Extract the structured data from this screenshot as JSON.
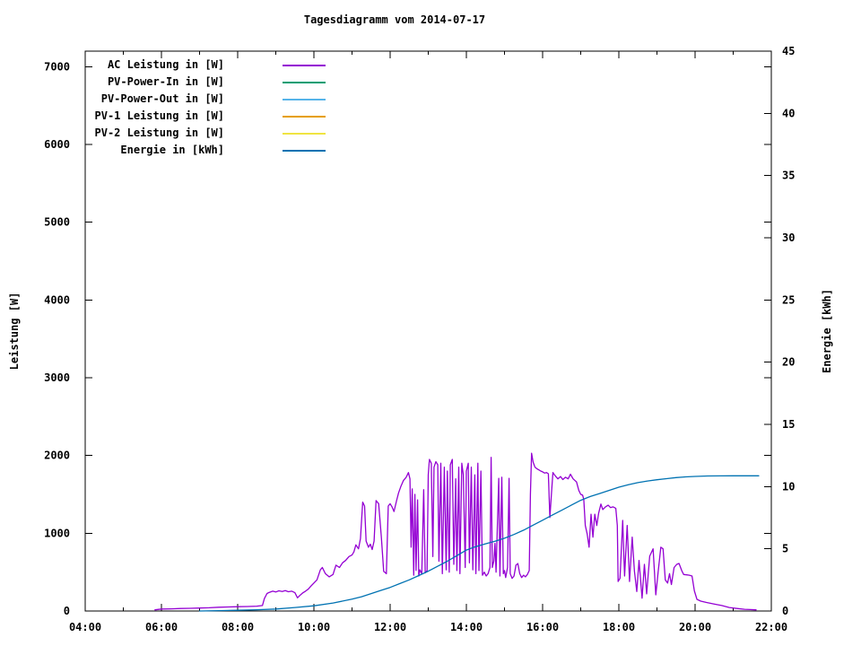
{
  "chart_data": {
    "type": "line",
    "title": "Tagesdiagramm vom 2014-07-17",
    "xlabel": "",
    "ylabel": "Leistung [W]",
    "y2label": "Energie [kWh]",
    "xlim": [
      4,
      22
    ],
    "ylim": [
      0,
      7200
    ],
    "y2lim": [
      0,
      45
    ],
    "x_major_ticks": [
      4,
      6,
      8,
      10,
      12,
      14,
      16,
      18,
      20,
      22
    ],
    "x_major_labels": [
      "04:00",
      "06:00",
      "08:00",
      "10:00",
      "12:00",
      "14:00",
      "16:00",
      "18:00",
      "20:00",
      "22:00"
    ],
    "x_minor_ticks": [
      5,
      7,
      9,
      11,
      13,
      15,
      17,
      19,
      21
    ],
    "y_ticks": [
      0,
      1000,
      2000,
      3000,
      4000,
      5000,
      6000,
      7000
    ],
    "y2_ticks": [
      0,
      5,
      10,
      15,
      20,
      25,
      30,
      35,
      40,
      45
    ],
    "grid": false,
    "legend_position": "top-left-inside",
    "series": [
      {
        "name": "AC Leistung in [W]",
        "color": "#9400d3",
        "axis": "y1",
        "points": [
          [
            5.83,
            15
          ],
          [
            6.0,
            25
          ],
          [
            6.25,
            28
          ],
          [
            6.5,
            32
          ],
          [
            6.75,
            35
          ],
          [
            7.0,
            38
          ],
          [
            7.25,
            42
          ],
          [
            7.5,
            48
          ],
          [
            7.75,
            52
          ],
          [
            8.0,
            55
          ],
          [
            8.25,
            58
          ],
          [
            8.5,
            62
          ],
          [
            8.65,
            70
          ],
          [
            8.7,
            160
          ],
          [
            8.77,
            225
          ],
          [
            8.83,
            240
          ],
          [
            8.92,
            255
          ],
          [
            9.0,
            245
          ],
          [
            9.08,
            260
          ],
          [
            9.17,
            250
          ],
          [
            9.25,
            262
          ],
          [
            9.33,
            248
          ],
          [
            9.42,
            255
          ],
          [
            9.5,
            235
          ],
          [
            9.57,
            170
          ],
          [
            9.63,
            200
          ],
          [
            9.7,
            230
          ],
          [
            9.78,
            255
          ],
          [
            9.85,
            280
          ],
          [
            9.92,
            320
          ],
          [
            10.0,
            360
          ],
          [
            10.08,
            400
          ],
          [
            10.17,
            530
          ],
          [
            10.22,
            560
          ],
          [
            10.3,
            480
          ],
          [
            10.4,
            440
          ],
          [
            10.5,
            470
          ],
          [
            10.58,
            590
          ],
          [
            10.67,
            560
          ],
          [
            10.75,
            620
          ],
          [
            10.83,
            650
          ],
          [
            10.92,
            700
          ],
          [
            11.0,
            720
          ],
          [
            11.05,
            760
          ],
          [
            11.1,
            850
          ],
          [
            11.17,
            800
          ],
          [
            11.22,
            930
          ],
          [
            11.28,
            1400
          ],
          [
            11.33,
            1350
          ],
          [
            11.37,
            900
          ],
          [
            11.43,
            820
          ],
          [
            11.48,
            860
          ],
          [
            11.53,
            790
          ],
          [
            11.58,
            900
          ],
          [
            11.63,
            1420
          ],
          [
            11.7,
            1380
          ],
          [
            11.77,
            950
          ],
          [
            11.83,
            510
          ],
          [
            11.9,
            480
          ],
          [
            11.95,
            1350
          ],
          [
            12.0,
            1380
          ],
          [
            12.05,
            1340
          ],
          [
            12.1,
            1280
          ],
          [
            12.17,
            1420
          ],
          [
            12.22,
            1520
          ],
          [
            12.28,
            1600
          ],
          [
            12.35,
            1680
          ],
          [
            12.42,
            1720
          ],
          [
            12.48,
            1780
          ],
          [
            12.52,
            1700
          ],
          [
            12.55,
            820
          ],
          [
            12.58,
            1570
          ],
          [
            12.62,
            460
          ],
          [
            12.65,
            1500
          ],
          [
            12.68,
            520
          ],
          [
            12.72,
            1430
          ],
          [
            12.75,
            450
          ],
          [
            12.78,
            530
          ],
          [
            12.83,
            480
          ],
          [
            12.88,
            1560
          ],
          [
            12.92,
            490
          ],
          [
            12.97,
            520
          ],
          [
            13.0,
            1750
          ],
          [
            13.03,
            1950
          ],
          [
            13.08,
            1900
          ],
          [
            13.12,
            700
          ],
          [
            13.15,
            1850
          ],
          [
            13.2,
            1920
          ],
          [
            13.25,
            1880
          ],
          [
            13.28,
            640
          ],
          [
            13.33,
            1900
          ],
          [
            13.37,
            480
          ],
          [
            13.42,
            1850
          ],
          [
            13.47,
            530
          ],
          [
            13.5,
            1800
          ],
          [
            13.55,
            500
          ],
          [
            13.58,
            1880
          ],
          [
            13.63,
            1950
          ],
          [
            13.67,
            600
          ],
          [
            13.72,
            1700
          ],
          [
            13.75,
            520
          ],
          [
            13.8,
            1850
          ],
          [
            13.83,
            480
          ],
          [
            13.88,
            1900
          ],
          [
            13.92,
            1750
          ],
          [
            13.97,
            560
          ],
          [
            14.0,
            1800
          ],
          [
            14.05,
            1900
          ],
          [
            14.08,
            620
          ],
          [
            14.13,
            1850
          ],
          [
            14.17,
            530
          ],
          [
            14.22,
            1750
          ],
          [
            14.25,
            480
          ],
          [
            14.3,
            1900
          ],
          [
            14.33,
            520
          ],
          [
            14.38,
            1800
          ],
          [
            14.42,
            460
          ],
          [
            14.47,
            500
          ],
          [
            14.52,
            450
          ],
          [
            14.57,
            480
          ],
          [
            14.62,
            560
          ],
          [
            14.65,
            1975
          ],
          [
            14.68,
            560
          ],
          [
            14.72,
            640
          ],
          [
            14.75,
            870
          ],
          [
            14.78,
            500
          ],
          [
            14.85,
            1705
          ],
          [
            14.88,
            450
          ],
          [
            14.93,
            1720
          ],
          [
            14.97,
            480
          ],
          [
            15.0,
            520
          ],
          [
            15.03,
            430
          ],
          [
            15.08,
            560
          ],
          [
            15.12,
            1705
          ],
          [
            15.15,
            480
          ],
          [
            15.2,
            420
          ],
          [
            15.25,
            450
          ],
          [
            15.3,
            590
          ],
          [
            15.35,
            610
          ],
          [
            15.4,
            480
          ],
          [
            15.45,
            430
          ],
          [
            15.5,
            460
          ],
          [
            15.55,
            440
          ],
          [
            15.6,
            470
          ],
          [
            15.65,
            520
          ],
          [
            15.68,
            1500
          ],
          [
            15.71,
            2030
          ],
          [
            15.75,
            1915
          ],
          [
            15.8,
            1850
          ],
          [
            15.85,
            1830
          ],
          [
            15.9,
            1815
          ],
          [
            15.95,
            1800
          ],
          [
            16.0,
            1790
          ],
          [
            16.05,
            1775
          ],
          [
            16.1,
            1780
          ],
          [
            16.15,
            1765
          ],
          [
            16.19,
            1203
          ],
          [
            16.23,
            1500
          ],
          [
            16.27,
            1780
          ],
          [
            16.33,
            1740
          ],
          [
            16.4,
            1700
          ],
          [
            16.47,
            1730
          ],
          [
            16.53,
            1690
          ],
          [
            16.6,
            1720
          ],
          [
            16.67,
            1700
          ],
          [
            16.73,
            1760
          ],
          [
            16.8,
            1700
          ],
          [
            16.89,
            1660
          ],
          [
            16.95,
            1550
          ],
          [
            17.0,
            1500
          ],
          [
            17.05,
            1490
          ],
          [
            17.08,
            1435
          ],
          [
            17.12,
            1100
          ],
          [
            17.17,
            990
          ],
          [
            17.22,
            820
          ],
          [
            17.27,
            1245
          ],
          [
            17.32,
            950
          ],
          [
            17.37,
            1245
          ],
          [
            17.42,
            1100
          ],
          [
            17.47,
            1260
          ],
          [
            17.53,
            1375
          ],
          [
            17.58,
            1305
          ],
          [
            17.65,
            1340
          ],
          [
            17.72,
            1360
          ],
          [
            17.78,
            1330
          ],
          [
            17.85,
            1340
          ],
          [
            17.92,
            1320
          ],
          [
            17.96,
            1100
          ],
          [
            17.98,
            380
          ],
          [
            18.03,
            420
          ],
          [
            18.1,
            1165
          ],
          [
            18.15,
            450
          ],
          [
            18.22,
            1100
          ],
          [
            18.28,
            380
          ],
          [
            18.35,
            950
          ],
          [
            18.41,
            510
          ],
          [
            18.47,
            250
          ],
          [
            18.53,
            650
          ],
          [
            18.61,
            165
          ],
          [
            18.67,
            600
          ],
          [
            18.73,
            220
          ],
          [
            18.81,
            705
          ],
          [
            18.9,
            800
          ],
          [
            18.97,
            208
          ],
          [
            19.03,
            500
          ],
          [
            19.1,
            820
          ],
          [
            19.16,
            800
          ],
          [
            19.22,
            400
          ],
          [
            19.28,
            360
          ],
          [
            19.33,
            480
          ],
          [
            19.38,
            340
          ],
          [
            19.45,
            560
          ],
          [
            19.52,
            600
          ],
          [
            19.58,
            611
          ],
          [
            19.65,
            520
          ],
          [
            19.7,
            470
          ],
          [
            19.78,
            465
          ],
          [
            19.85,
            460
          ],
          [
            19.92,
            450
          ],
          [
            19.98,
            260
          ],
          [
            20.05,
            150
          ],
          [
            20.15,
            127
          ],
          [
            20.3,
            110
          ],
          [
            20.5,
            90
          ],
          [
            20.7,
            70
          ],
          [
            20.9,
            45
          ],
          [
            21.1,
            32
          ],
          [
            21.3,
            22
          ],
          [
            21.45,
            18
          ],
          [
            21.6,
            15
          ]
        ]
      },
      {
        "name": "PV-Power-In in [W]",
        "color": "#009e73",
        "axis": "y1",
        "points": []
      },
      {
        "name": "PV-Power-Out in [W]",
        "color": "#56b4e9",
        "axis": "y1",
        "points": []
      },
      {
        "name": "PV-1 Leistung in [W]",
        "color": "#e69f00",
        "axis": "y1",
        "points": []
      },
      {
        "name": "PV-2 Leistung in [W]",
        "color": "#f0e442",
        "axis": "y1",
        "points": []
      },
      {
        "name": "Energie in [kWh]",
        "color": "#0072b2",
        "axis": "y2",
        "points": [
          [
            7.0,
            0
          ],
          [
            7.5,
            0.03
          ],
          [
            8.0,
            0.06
          ],
          [
            8.5,
            0.1
          ],
          [
            9.0,
            0.16
          ],
          [
            9.5,
            0.28
          ],
          [
            10.0,
            0.42
          ],
          [
            10.5,
            0.64
          ],
          [
            11.0,
            0.95
          ],
          [
            11.25,
            1.15
          ],
          [
            11.5,
            1.4
          ],
          [
            11.75,
            1.65
          ],
          [
            12.0,
            1.9
          ],
          [
            12.25,
            2.2
          ],
          [
            12.5,
            2.5
          ],
          [
            12.75,
            2.85
          ],
          [
            13.0,
            3.2
          ],
          [
            13.25,
            3.6
          ],
          [
            13.5,
            4.0
          ],
          [
            13.75,
            4.45
          ],
          [
            14.0,
            4.9
          ],
          [
            14.17,
            5.1
          ],
          [
            14.33,
            5.25
          ],
          [
            14.5,
            5.4
          ],
          [
            14.75,
            5.6
          ],
          [
            15.0,
            5.85
          ],
          [
            15.25,
            6.15
          ],
          [
            15.5,
            6.5
          ],
          [
            15.75,
            6.9
          ],
          [
            16.0,
            7.3
          ],
          [
            16.25,
            7.7
          ],
          [
            16.5,
            8.1
          ],
          [
            16.75,
            8.5
          ],
          [
            17.0,
            8.9
          ],
          [
            17.25,
            9.2
          ],
          [
            17.5,
            9.45
          ],
          [
            17.75,
            9.7
          ],
          [
            18.0,
            9.95
          ],
          [
            18.25,
            10.15
          ],
          [
            18.5,
            10.32
          ],
          [
            18.75,
            10.45
          ],
          [
            19.0,
            10.55
          ],
          [
            19.25,
            10.64
          ],
          [
            19.5,
            10.72
          ],
          [
            19.75,
            10.78
          ],
          [
            20.0,
            10.82
          ],
          [
            20.33,
            10.85
          ],
          [
            20.67,
            10.86
          ],
          [
            21.0,
            10.87
          ],
          [
            21.33,
            10.87
          ],
          [
            21.67,
            10.87
          ]
        ]
      }
    ],
    "colors": {
      "text": "#000000",
      "border": "#000000",
      "background": "#ffffff"
    }
  }
}
